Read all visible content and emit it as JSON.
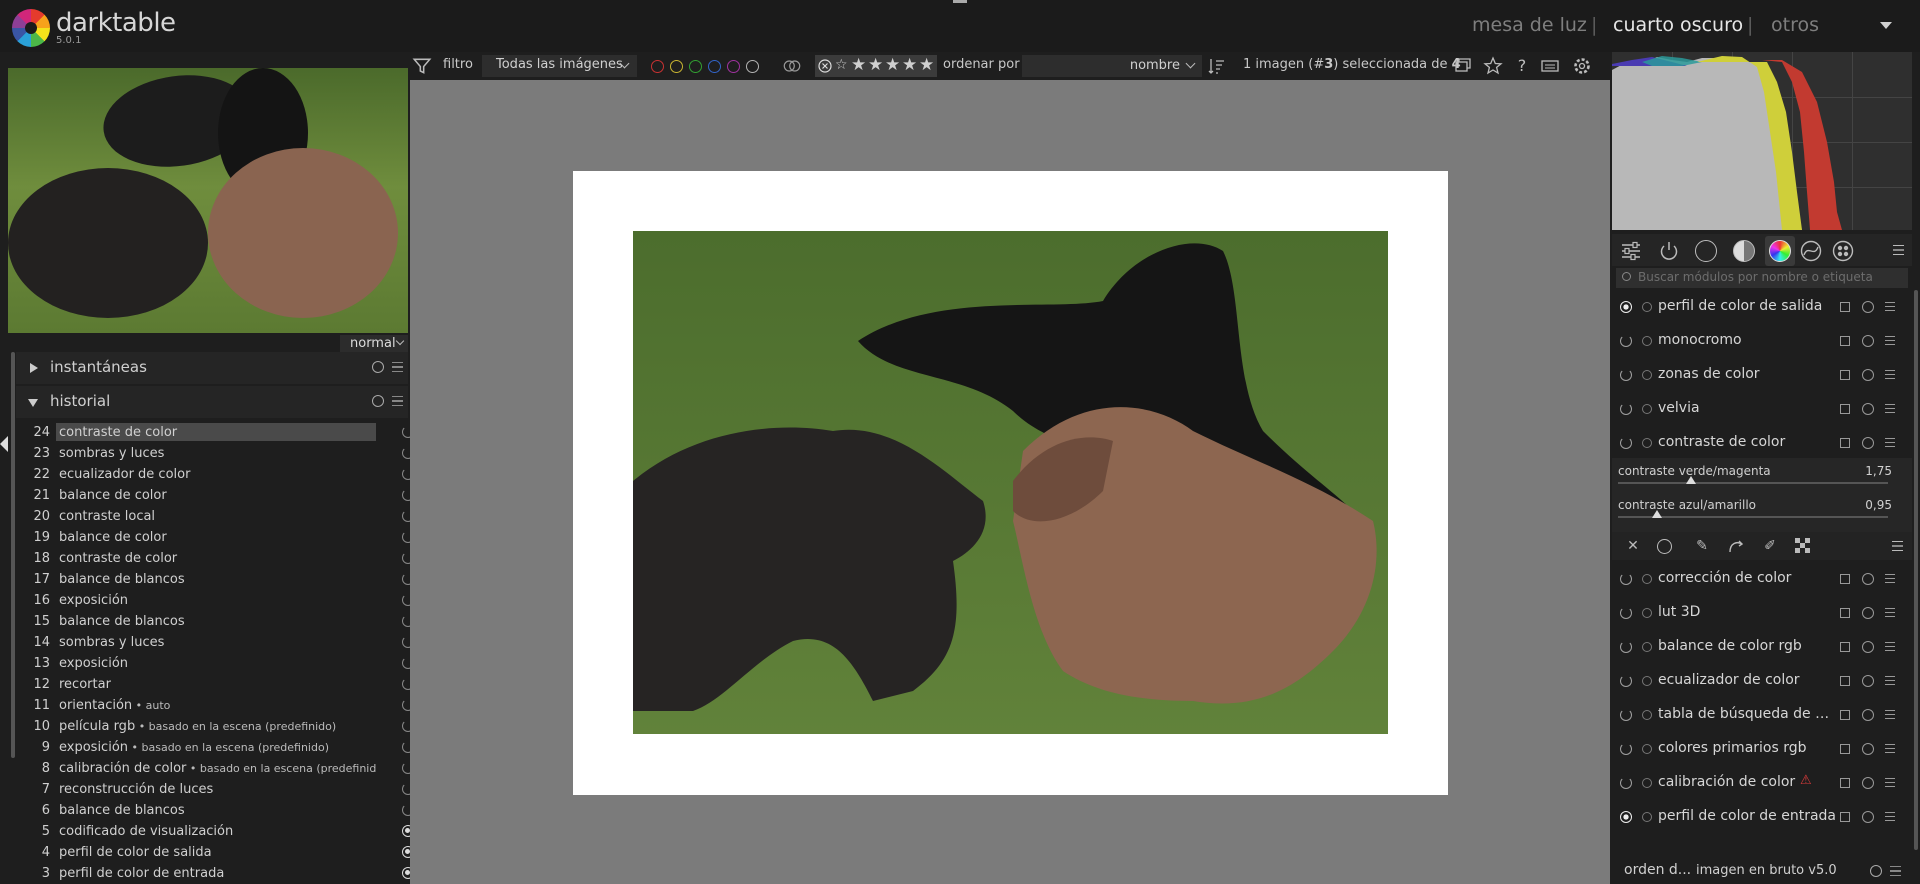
{
  "app": {
    "name": "darktable",
    "version": "5.0.1"
  },
  "views": {
    "lighttable": "mesa de luz",
    "darkroom": "cuarto oscuro",
    "other": "otros",
    "separator": "|"
  },
  "toolbar": {
    "filter_label": "filtro",
    "filter_value": "Todas las imágenes",
    "sort_label": "ordenar por",
    "sort_value": "nombre",
    "selection_pre": "1 imagen (#",
    "selection_num": "3",
    "selection_mid": ") seleccionada de ",
    "selection_total": "4",
    "color_labels": [
      "#c83232",
      "#c8b432",
      "#32a032",
      "#3264c8",
      "#a032a0",
      "#b4b4b4"
    ]
  },
  "left": {
    "blend_mode": "normal",
    "snapshots": "instantáneas",
    "history": "historial",
    "items": [
      {
        "n": "24",
        "label": "contraste de color",
        "suffix": "",
        "power": "off",
        "selected": true
      },
      {
        "n": "23",
        "label": "sombras y luces",
        "suffix": "",
        "power": "off"
      },
      {
        "n": "22",
        "label": "ecualizador de color",
        "suffix": "",
        "power": "off"
      },
      {
        "n": "21",
        "label": "balance de color",
        "suffix": "",
        "power": "off"
      },
      {
        "n": "20",
        "label": "contraste local",
        "suffix": "",
        "power": "off"
      },
      {
        "n": "19",
        "label": "balance de color",
        "suffix": "",
        "power": "off"
      },
      {
        "n": "18",
        "label": "contraste de color",
        "suffix": "",
        "power": "off"
      },
      {
        "n": "17",
        "label": "balance de blancos",
        "suffix": "",
        "power": "off"
      },
      {
        "n": "16",
        "label": "exposición",
        "suffix": "",
        "power": "off"
      },
      {
        "n": "15",
        "label": "balance de blancos",
        "suffix": "",
        "power": "off"
      },
      {
        "n": "14",
        "label": "sombras y luces",
        "suffix": "",
        "power": "off"
      },
      {
        "n": "13",
        "label": "exposición",
        "suffix": "",
        "power": "off"
      },
      {
        "n": "12",
        "label": "recortar",
        "suffix": "",
        "power": "off"
      },
      {
        "n": "11",
        "label": "orientación",
        "suffix": " • auto",
        "power": "off"
      },
      {
        "n": "10",
        "label": "película rgb",
        "suffix": " • basado en la escena (predefinido)",
        "power": "off"
      },
      {
        "n": "9",
        "label": "exposición",
        "suffix": " • basado en la escena (predefinido)",
        "power": "off"
      },
      {
        "n": "8",
        "label": "calibración de color",
        "suffix": " • basado en la escena (predefinido)",
        "power": "off"
      },
      {
        "n": "7",
        "label": "reconstrucción de luces",
        "suffix": "",
        "power": "off"
      },
      {
        "n": "6",
        "label": "balance de blancos",
        "suffix": "",
        "power": "off"
      },
      {
        "n": "5",
        "label": "codificado de visualización",
        "suffix": "",
        "power": "on"
      },
      {
        "n": "4",
        "label": "perfil de color de salida",
        "suffix": "",
        "power": "on"
      },
      {
        "n": "3",
        "label": "perfil de color de entrada",
        "suffix": "",
        "power": "on"
      }
    ]
  },
  "right": {
    "search_placeholder": "Buscar módulos por nombre o etiqueta",
    "modules_top": [
      {
        "name": "perfil de color de salida",
        "power": "on"
      },
      {
        "name": "monocromo",
        "power": "off"
      },
      {
        "name": "zonas de color",
        "power": "off"
      },
      {
        "name": "velvia",
        "power": "off"
      },
      {
        "name": "contraste de color",
        "power": "off"
      }
    ],
    "sliders": [
      {
        "label": "contraste verde/magenta",
        "value": "1,75",
        "fraction": 0.27
      },
      {
        "label": "contraste azul/amarillo",
        "value": "0,95",
        "fraction": 0.145
      }
    ],
    "modules_bottom": [
      {
        "name": "corrección de color",
        "power": "off",
        "warn": false
      },
      {
        "name": "lut 3D",
        "power": "off",
        "warn": false
      },
      {
        "name": "balance de color rgb",
        "power": "off",
        "warn": false
      },
      {
        "name": "ecualizador de color",
        "power": "off",
        "warn": false
      },
      {
        "name": "tabla de búsqueda de color",
        "power": "off",
        "warn": false
      },
      {
        "name": "colores primarios rgb",
        "power": "off",
        "warn": false
      },
      {
        "name": "calibración de color",
        "power": "off",
        "warn": true
      },
      {
        "name": "perfil de color de entrada",
        "power": "on",
        "warn": false
      }
    ],
    "module_order_label": "orden d...",
    "module_order_value": "imagen en bruto v5.0"
  }
}
